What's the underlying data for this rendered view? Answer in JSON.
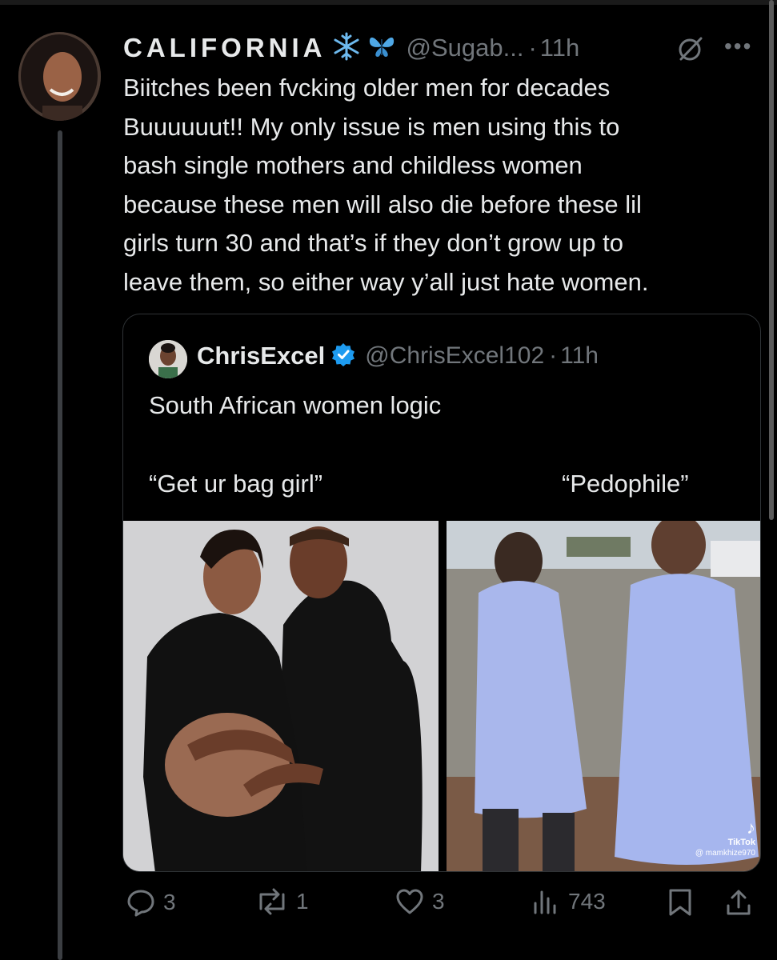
{
  "tweet": {
    "author_name": "CALIFORNIA",
    "author_emojis": [
      "snowflake-emoji",
      "butterfly-emoji"
    ],
    "handle": "@Sugab...",
    "time": "11h",
    "text": "Biitches been fvcking older men for decades\nBuuuuuut!! My only issue is men using this to\nbash single mothers and childless women\nbecause these men will also die before these lil\ngirls turn 30 and that’s if they don’t grow up to\nleave them, so either way y’all just hate women."
  },
  "quote": {
    "author_name": "ChrisExcel",
    "verified": true,
    "handle": "@ChrisExcel102",
    "time": "11h",
    "text": "South African women logic",
    "left_caption": "“Get ur bag girl”",
    "right_caption": "“Pedophile”",
    "watermark_brand": "TikTok",
    "watermark_user": "@ mamkhize970"
  },
  "actions": {
    "replies": "3",
    "reposts": "1",
    "likes": "3",
    "views": "743"
  },
  "icons": [
    "grok-icon",
    "more-icon",
    "reply-icon",
    "repost-icon",
    "like-icon",
    "views-icon",
    "bookmark-icon",
    "share-icon"
  ],
  "colors": {
    "background": "#000000",
    "text": "#e7e9ea",
    "muted": "#71767b",
    "verified": "#1d9bf0",
    "border": "#2f3336",
    "emoji_blue": "#5fb0e8"
  }
}
